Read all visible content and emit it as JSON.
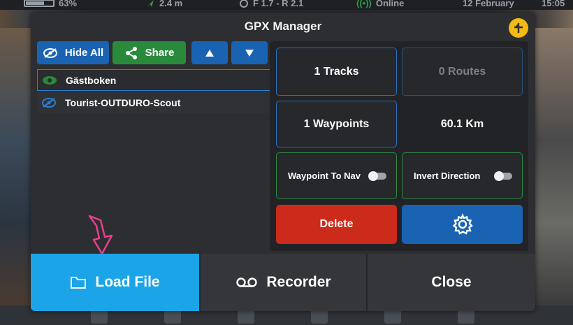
{
  "status_bar": {
    "battery": "63%",
    "distance": "2.4 m",
    "gear": "F 1.7 - R 2.1",
    "connection": "Online",
    "date": "12 February",
    "time": "15:05"
  },
  "dialog": {
    "title": "GPX Manager",
    "toolbar": {
      "hide_all_label": "Hide All",
      "share_label": "Share",
      "up_icon": "triangle-up",
      "down_icon": "triangle-down"
    },
    "files": [
      {
        "name": "Gästboken",
        "visible": true,
        "selected": true
      },
      {
        "name": "Tourist-OUTDURO-Scout",
        "visible": false,
        "selected": false
      }
    ],
    "stats": {
      "tracks": "1 Tracks",
      "routes": "0 Routes",
      "waypoints": "1 Waypoints",
      "distance": "60.1 Km"
    },
    "toggles": {
      "waypoint_to_nav": {
        "label": "Waypoint To Nav",
        "on": false
      },
      "invert_direction": {
        "label": "Invert Direction",
        "on": false
      }
    },
    "actions": {
      "delete_label": "Delete",
      "settings_icon": "gear-icon"
    },
    "bottom": {
      "load_file_label": "Load File",
      "recorder_label": "Recorder",
      "close_label": "Close"
    }
  },
  "colors": {
    "accent_blue": "#1a63b3",
    "light_blue": "#1ba5e8",
    "green": "#2a8a3c",
    "red": "#cc2a1b",
    "yellow": "#f5b914",
    "pink_annotation": "#e6408f"
  }
}
